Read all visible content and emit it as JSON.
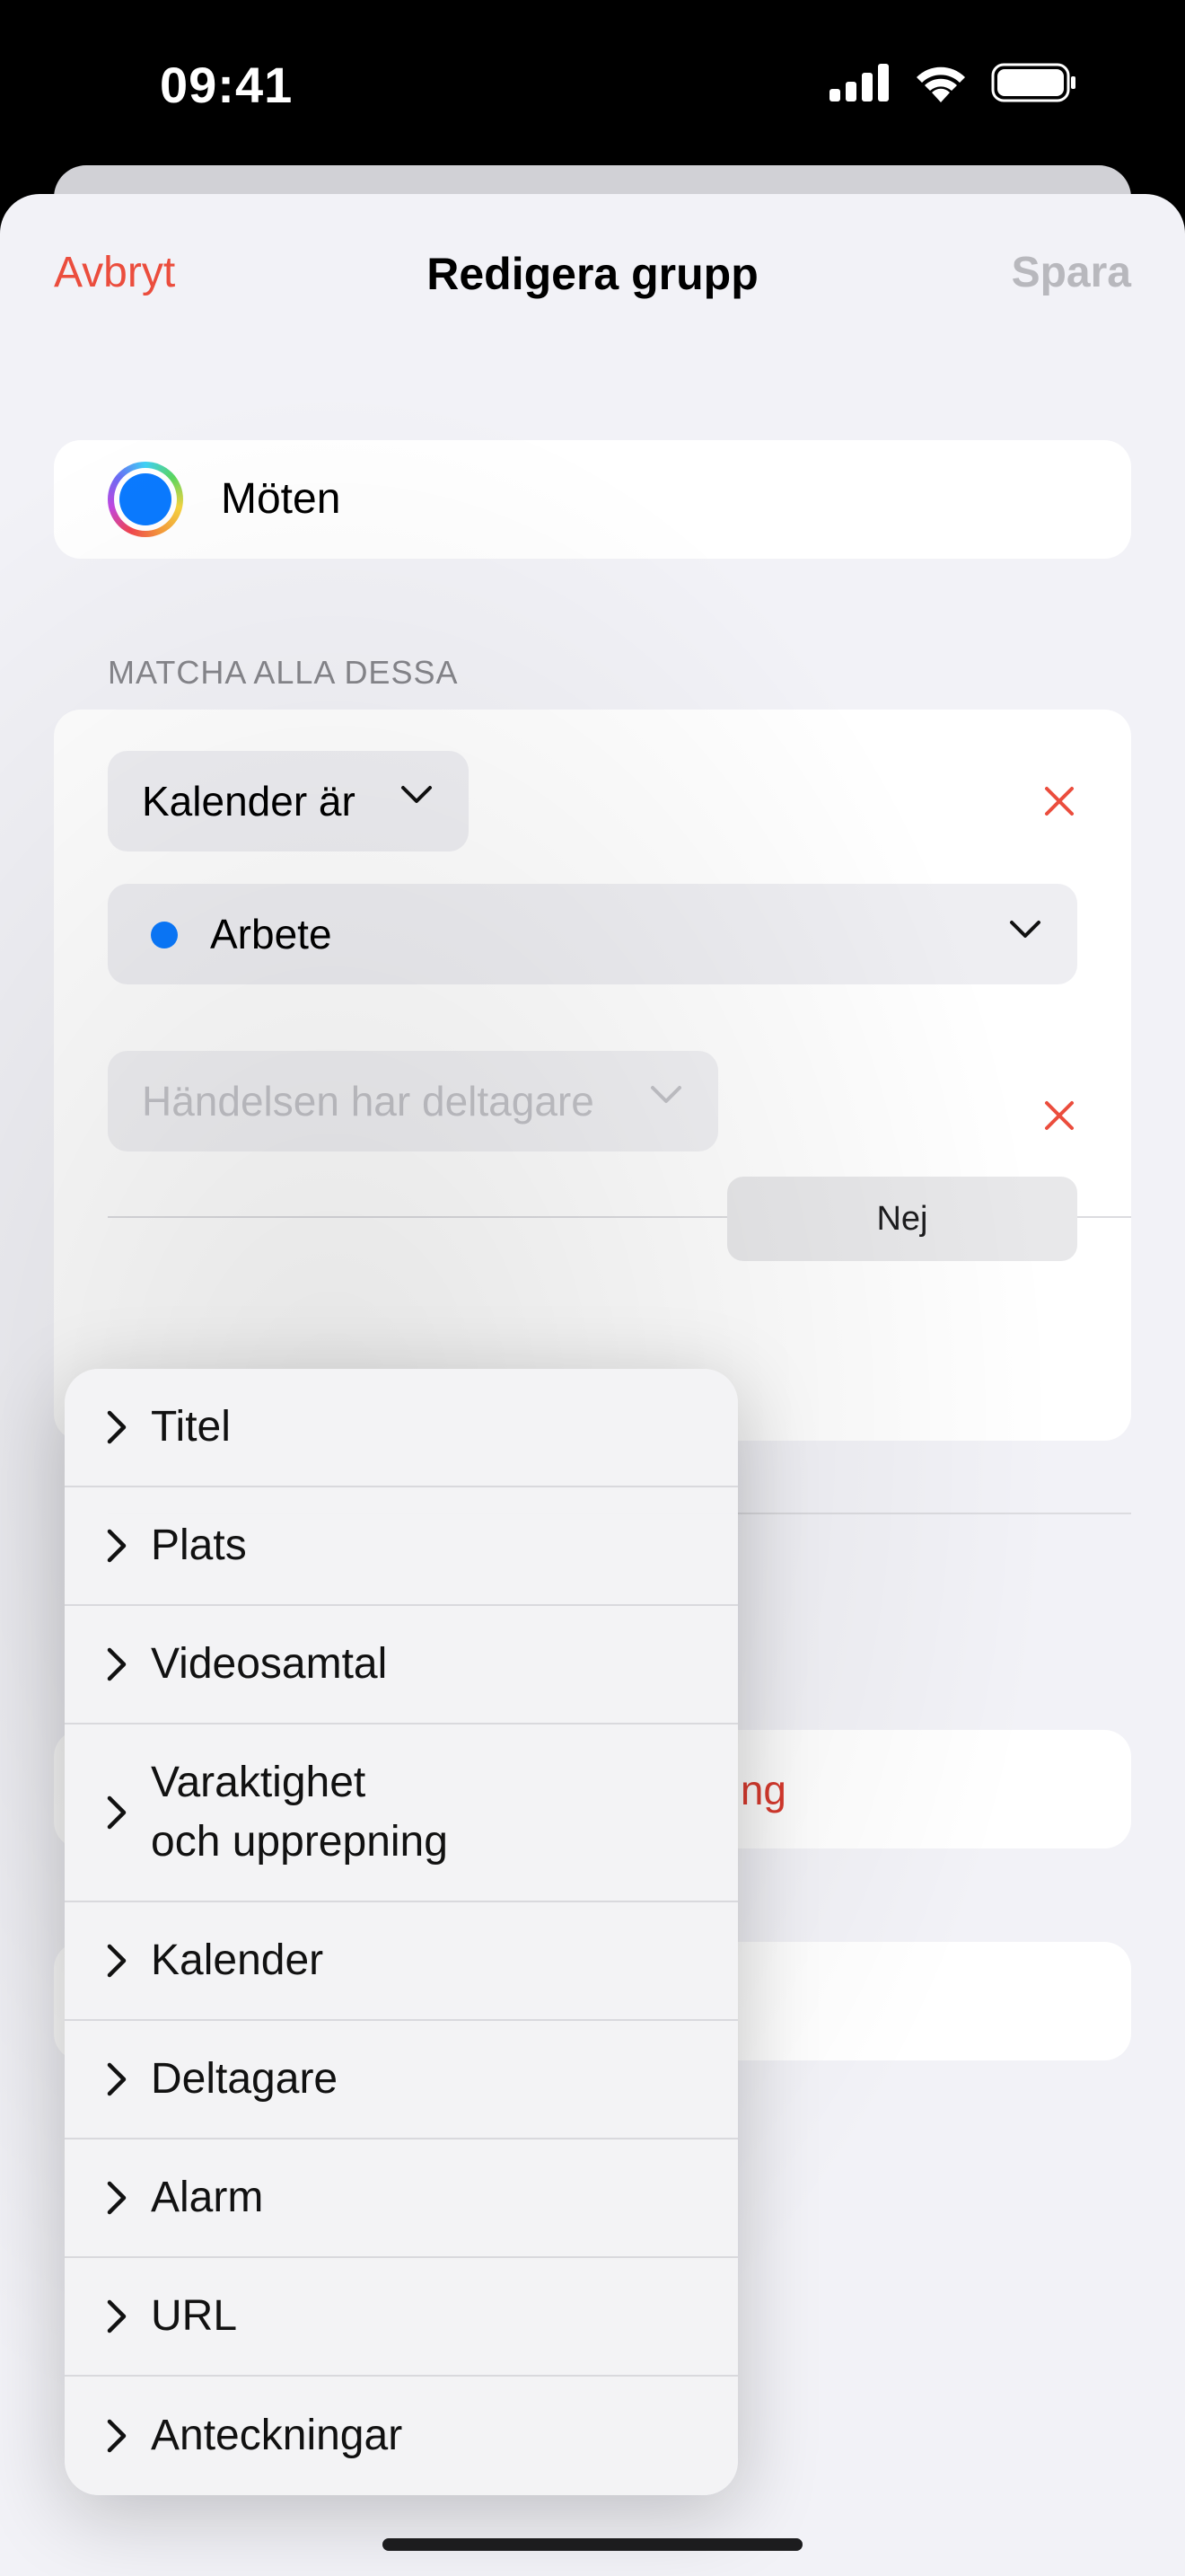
{
  "status_bar": {
    "time": "09:41",
    "icons": [
      "cellular-signal-icon",
      "wifi-icon",
      "battery-icon"
    ]
  },
  "nav": {
    "cancel_label": "Avbryt",
    "title": "Redigera grupp",
    "save_label": "Spara"
  },
  "group": {
    "name": "Möten",
    "icon": "color-ring-icon"
  },
  "rules_section": {
    "header": "MATCHA ALLA DESSA",
    "rule1": {
      "field": "Kalender är",
      "value": "Arbete",
      "value_color": "#0a7aff"
    },
    "rule2": {
      "field": "Händelsen har deltagare",
      "segment_option": "Nej"
    }
  },
  "partial_red_text": "ng",
  "menu": {
    "items": [
      {
        "label": "Titel",
        "height": 132
      },
      {
        "label": "Plats",
        "height": 132
      },
      {
        "label": "Videosamtal",
        "height": 132
      },
      {
        "label": "Varaktighet\noch upprepning",
        "height": 198
      },
      {
        "label": "Kalender",
        "height": 132
      },
      {
        "label": "Deltagare",
        "height": 132
      },
      {
        "label": "Alarm",
        "height": 132
      },
      {
        "label": "URL",
        "height": 132
      },
      {
        "label": "Anteckningar",
        "height": 132
      }
    ]
  },
  "colors": {
    "accent_red": "#eb4d3d",
    "disabled_gray": "#b8b8bd",
    "calendar_blue": "#0a7aff"
  }
}
